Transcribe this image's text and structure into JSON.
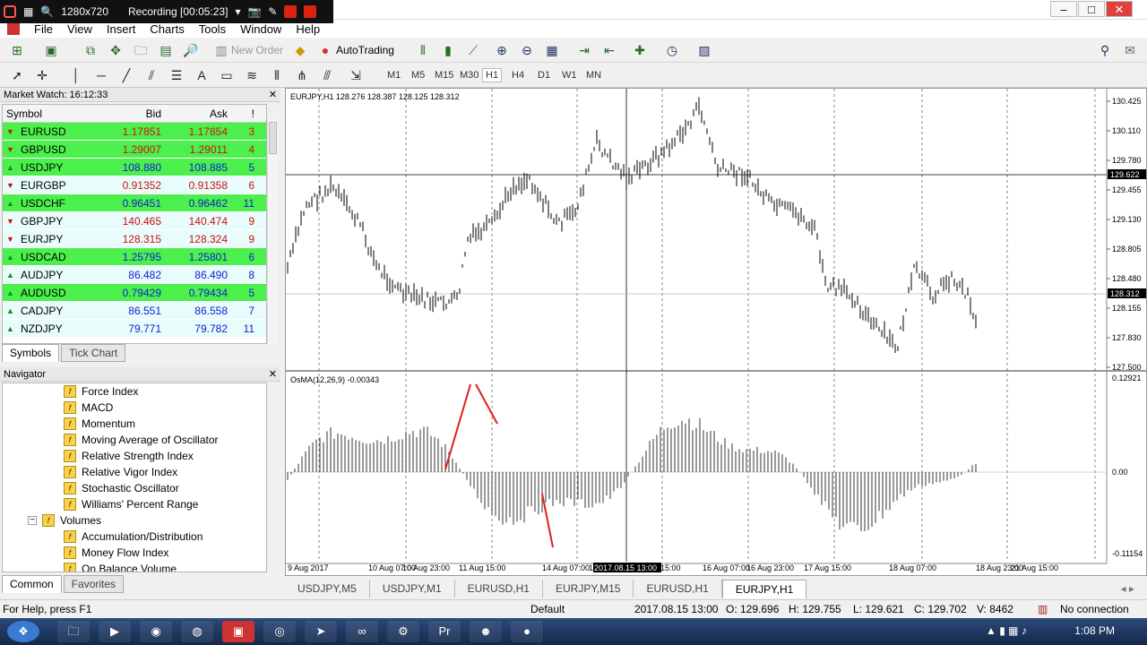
{
  "recorder": {
    "resolution": "1280x720",
    "status": "Recording [00:05:23]"
  },
  "menu": [
    "File",
    "View",
    "Insert",
    "Charts",
    "Tools",
    "Window",
    "Help"
  ],
  "toolbar": {
    "new_order": "New Order",
    "autotrading": "AutoTrading",
    "timeframes": [
      "M1",
      "M5",
      "M15",
      "M30",
      "H1",
      "H4",
      "D1",
      "W1",
      "MN"
    ]
  },
  "market_watch": {
    "title": "Market Watch: 16:12:33",
    "columns": [
      "Symbol",
      "Bid",
      "Ask",
      "!"
    ],
    "rows": [
      {
        "symbol": "EURUSD",
        "bid": "1.17851",
        "ask": "1.17854",
        "spread": "3",
        "bg": "#4cf04c",
        "color": "#d01010",
        "dir": "down"
      },
      {
        "symbol": "GBPUSD",
        "bid": "1.29007",
        "ask": "1.29011",
        "spread": "4",
        "bg": "#4cf04c",
        "color": "#d01010",
        "dir": "down"
      },
      {
        "symbol": "USDJPY",
        "bid": "108.880",
        "ask": "108.885",
        "spread": "5",
        "bg": "#4cf04c",
        "color": "#1020d0",
        "dir": "up"
      },
      {
        "symbol": "EURGBP",
        "bid": "0.91352",
        "ask": "0.91358",
        "spread": "6",
        "bg": "#e8fcfc",
        "color": "#d01010",
        "dir": "down"
      },
      {
        "symbol": "USDCHF",
        "bid": "0.96451",
        "ask": "0.96462",
        "spread": "11",
        "bg": "#4cf04c",
        "color": "#1020d0",
        "dir": "up"
      },
      {
        "symbol": "GBPJPY",
        "bid": "140.465",
        "ask": "140.474",
        "spread": "9",
        "bg": "#e8fcfc",
        "color": "#d01010",
        "dir": "down"
      },
      {
        "symbol": "EURJPY",
        "bid": "128.315",
        "ask": "128.324",
        "spread": "9",
        "bg": "#e8fcfc",
        "color": "#d01010",
        "dir": "down"
      },
      {
        "symbol": "USDCAD",
        "bid": "1.25795",
        "ask": "1.25801",
        "spread": "6",
        "bg": "#4cf04c",
        "color": "#1020d0",
        "dir": "up"
      },
      {
        "symbol": "AUDJPY",
        "bid": "86.482",
        "ask": "86.490",
        "spread": "8",
        "bg": "#e8fcfc",
        "color": "#1020d0",
        "dir": "up"
      },
      {
        "symbol": "AUDUSD",
        "bid": "0.79429",
        "ask": "0.79434",
        "spread": "5",
        "bg": "#4cf04c",
        "color": "#1020d0",
        "dir": "up"
      },
      {
        "symbol": "CADJPY",
        "bid": "86.551",
        "ask": "86.558",
        "spread": "7",
        "bg": "#e8fcfc",
        "color": "#1020d0",
        "dir": "up"
      },
      {
        "symbol": "NZDJPY",
        "bid": "79.771",
        "ask": "79.782",
        "spread": "11",
        "bg": "#e8fcfc",
        "color": "#1020d0",
        "dir": "up"
      }
    ],
    "tabs": [
      "Symbols",
      "Tick Chart"
    ]
  },
  "navigator": {
    "title": "Navigator",
    "items": [
      {
        "label": "Force Index",
        "folder": false
      },
      {
        "label": "MACD",
        "folder": false
      },
      {
        "label": "Momentum",
        "folder": false
      },
      {
        "label": "Moving Average of Oscillator",
        "folder": false
      },
      {
        "label": "Relative Strength Index",
        "folder": false
      },
      {
        "label": "Relative Vigor Index",
        "folder": false
      },
      {
        "label": "Stochastic Oscillator",
        "folder": false
      },
      {
        "label": "Williams' Percent Range",
        "folder": false
      },
      {
        "label": "Volumes",
        "folder": true
      },
      {
        "label": "Accumulation/Distribution",
        "folder": false
      },
      {
        "label": "Money Flow Index",
        "folder": false
      },
      {
        "label": "On Balance Volume",
        "folder": false
      }
    ],
    "tabs": [
      "Common",
      "Favorites"
    ]
  },
  "chart": {
    "header": "EURJPY,H1  128.276 128.387 128.125 128.312",
    "indicator_label": "OsMA(12,26,9) -0.00343",
    "price_labels": [
      "130.425",
      "130.110",
      "129.780",
      "129.455",
      "129.130",
      "128.805",
      "128.480",
      "128.155",
      "127.830",
      "127.500"
    ],
    "crosshair_price": "129.622",
    "current_price": "128.312",
    "ind_labels": [
      "0.12921",
      "0.00",
      "-0.11154"
    ],
    "date_labels": [
      "9 Aug 2017",
      "10 Aug 07:00",
      "10 Aug 23:00",
      "11 Aug 15:00",
      "14 Aug 07:00",
      "14 A",
      "2017.08.15 13:00",
      "15:00",
      "16 Aug 07:00",
      "16 Aug 23:00",
      "17 Aug 15:00",
      "18 Aug 07:00",
      "18 Aug 23:00",
      "21 Aug 15:00"
    ]
  },
  "chart_tabs": [
    "USDJPY,M5",
    "USDJPY,M1",
    "EURUSD,H1",
    "EURJPY,M15",
    "EURUSD,H1",
    "EURJPY,H1"
  ],
  "status": {
    "help": "For Help, press F1",
    "profile": "Default",
    "time": "2017.08.15 13:00",
    "open": "O: 129.696",
    "high": "H: 129.755",
    "low": "L: 129.621",
    "close": "C: 129.702",
    "volume": "V: 8462",
    "connection": "No connection"
  },
  "taskbar": {
    "time": "1:08 PM"
  }
}
